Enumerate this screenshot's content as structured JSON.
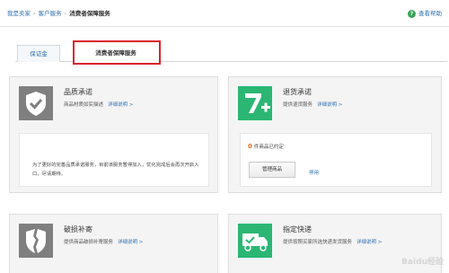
{
  "breadcrumb": {
    "home": "我是卖家",
    "section": "客户服务",
    "current": "消费者保障服务"
  },
  "help": {
    "label": "查看帮助",
    "icon": "question-icon"
  },
  "tabs": [
    {
      "label": "保证金",
      "active": false
    },
    {
      "label": "消费者保障服务",
      "active": true,
      "highlighted": true
    }
  ],
  "cards": {
    "quality": {
      "title": "品质承诺",
      "desc": "商品材质如实描述",
      "link": "详细说明 >",
      "notice": "为了更好的完善品质承诺服务，目前该服务暂停加入，优化完成后会再次开启入口，尽请期待。",
      "icon": "shield-check-icon"
    },
    "return": {
      "title": "退货承诺",
      "desc": "提供退货服务",
      "link": "详细说明 >",
      "count": "0",
      "count_suffix": "件商品已约定",
      "manage_button": "管理商品",
      "disable_link": "停用",
      "icon": "seven-plus-icon"
    },
    "damage": {
      "title": "破损补寄",
      "desc": "提供商品破损补寄服务",
      "link": "详细说明 >",
      "icon": "broken-shield-icon"
    },
    "express": {
      "title": "指定快递",
      "desc": "提供按照买家所选快递发货服务",
      "link": "详细说明 >",
      "icon": "delivery-truck-icon"
    }
  },
  "watermark": "Baidu经验",
  "colors": {
    "link": "#2f6fb0",
    "highlight_border": "#d9232b",
    "quality_icon_bg": "#7f7f7f",
    "return_icon_bg": "#2bb673",
    "express_icon_bg": "#2bb673",
    "count_color": "#e46d1d"
  }
}
